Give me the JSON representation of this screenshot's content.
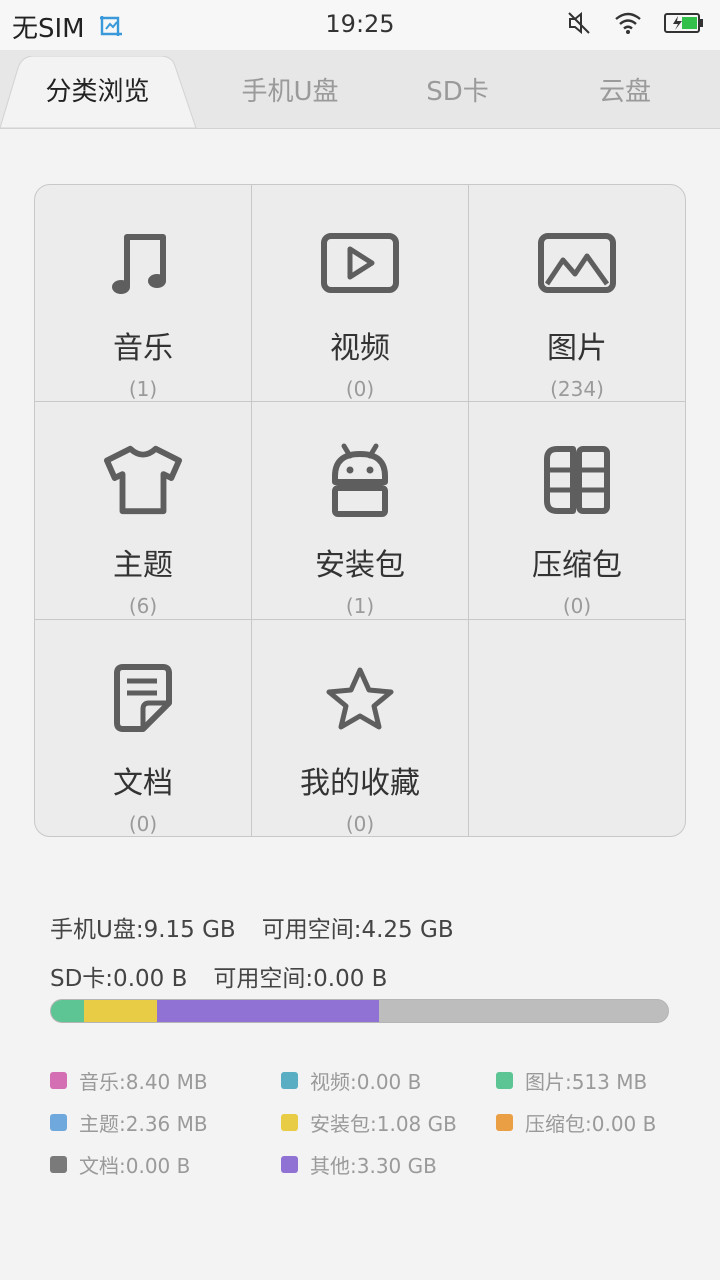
{
  "status_bar": {
    "carrier": "无SIM",
    "time": "19:25",
    "icons": [
      "screenshot-icon",
      "mute-icon",
      "wifi-icon",
      "battery-icon"
    ]
  },
  "tabs": [
    {
      "label": "分类浏览",
      "active": true
    },
    {
      "label": "手机U盘",
      "active": false
    },
    {
      "label": "SD卡",
      "active": false
    },
    {
      "label": "云盘",
      "active": false
    }
  ],
  "categories": [
    {
      "label": "音乐",
      "count": "(1)",
      "icon": "music-icon"
    },
    {
      "label": "视频",
      "count": "(0)",
      "icon": "video-icon"
    },
    {
      "label": "图片",
      "count": "(234)",
      "icon": "image-icon"
    },
    {
      "label": "主题",
      "count": "(6)",
      "icon": "theme-shirt-icon"
    },
    {
      "label": "安装包",
      "count": "(1)",
      "icon": "android-icon"
    },
    {
      "label": "压缩包",
      "count": "(0)",
      "icon": "archive-icon"
    },
    {
      "label": "文档",
      "count": "(0)",
      "icon": "document-icon"
    },
    {
      "label": "我的收藏",
      "count": "(0)",
      "icon": "star-icon"
    }
  ],
  "storage": {
    "phone": {
      "total": "手机U盘:9.15 GB",
      "free": "可用空间:4.25 GB"
    },
    "sd": {
      "total": "SD卡:0.00 B",
      "free": "可用空间:0.00 B"
    },
    "usage_segments": [
      {
        "name": "图片",
        "fraction": 0.054,
        "color": "#5cc593"
      },
      {
        "name": "安装包",
        "fraction": 0.117,
        "color": "#e8cc45"
      },
      {
        "name": "其他",
        "fraction": 0.36,
        "color": "#8f72d3"
      }
    ],
    "track_color": "#bdbdbd"
  },
  "legend": [
    {
      "text": "音乐:8.40 MB",
      "color": "#d56fb4"
    },
    {
      "text": "视频:0.00 B",
      "color": "#5aaec3"
    },
    {
      "text": "图片:513 MB",
      "color": "#5cc593"
    },
    {
      "text": "主题:2.36 MB",
      "color": "#6fa8dc"
    },
    {
      "text": "安装包:1.08 GB",
      "color": "#e8cc45"
    },
    {
      "text": "压缩包:0.00 B",
      "color": "#ea9f45"
    },
    {
      "text": "文档:0.00 B",
      "color": "#7a7a7a"
    },
    {
      "text": "其他:3.30 GB",
      "color": "#8f72d3"
    }
  ]
}
